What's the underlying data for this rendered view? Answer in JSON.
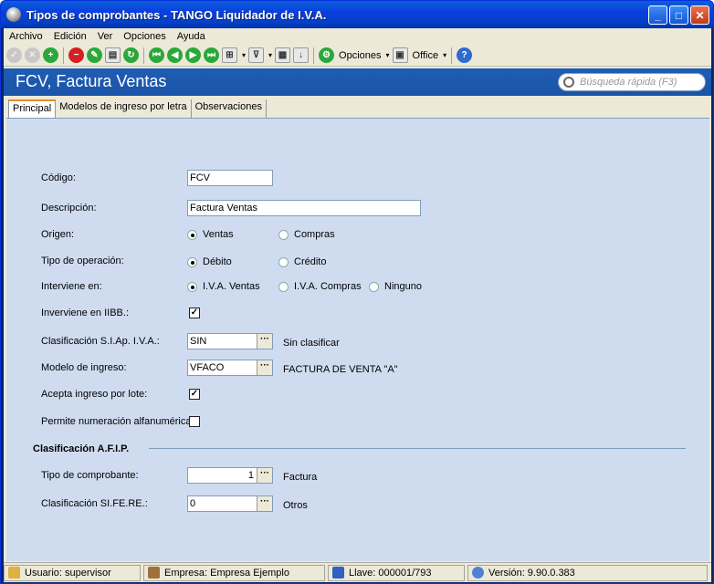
{
  "window": {
    "title": "Tipos de comprobantes - TANGO Liquidador de I.V.A."
  },
  "menu": {
    "items": [
      "Archivo",
      "Edición",
      "Ver",
      "Opciones",
      "Ayuda"
    ]
  },
  "toolbar": {
    "opciones_label": "Opciones",
    "office_label": "Office"
  },
  "header": {
    "title": "FCV, Factura Ventas",
    "search_placeholder": "Búsqueda rápida (F3)"
  },
  "tabs": [
    "Principal",
    "Modelos de ingreso por letra",
    "Observaciones"
  ],
  "form": {
    "codigo_label": "Código:",
    "codigo_value": "FCV",
    "descripcion_label": "Descripción:",
    "descripcion_value": "Factura Ventas",
    "origen_label": "Origen:",
    "origen_options": [
      "Ventas",
      "Compras"
    ],
    "origen_selected": "Ventas",
    "tipo_op_label": "Tipo de operación:",
    "tipo_op_options": [
      "Débito",
      "Crédito"
    ],
    "tipo_op_selected": "Débito",
    "interviene_label": "Interviene en:",
    "interviene_options": [
      "I.V.A. Ventas",
      "I.V.A. Compras",
      "Ninguno"
    ],
    "interviene_selected": "I.V.A. Ventas",
    "iibb_label": "Inverviene en IIBB.:",
    "iibb_checked": true,
    "siap_label": "Clasificación S.I.Ap. I.V.A.:",
    "siap_value": "SIN",
    "siap_desc": "Sin clasificar",
    "modelo_label": "Modelo de ingreso:",
    "modelo_value": "VFACO",
    "modelo_desc": "FACTURA DE  VENTA \"A\"",
    "lote_label": "Acepta ingreso por lote:",
    "lote_checked": true,
    "alfa_label": "Permite numeración alfanumérica:",
    "alfa_checked": false,
    "afip_section": "Clasificación A.F.I.P.",
    "tipo_comp_label": "Tipo de comprobante:",
    "tipo_comp_value": "1",
    "tipo_comp_desc": "Factura",
    "sifere_label": "Clasificación SI.FE.RE.:",
    "sifere_value": "0",
    "sifere_desc": "Otros"
  },
  "status": {
    "usuario": "Usuario: supervisor",
    "empresa": "Empresa: Empresa Ejemplo",
    "llave": "Llave: 000001/793",
    "version": "Versión: 9.90.0.383"
  }
}
